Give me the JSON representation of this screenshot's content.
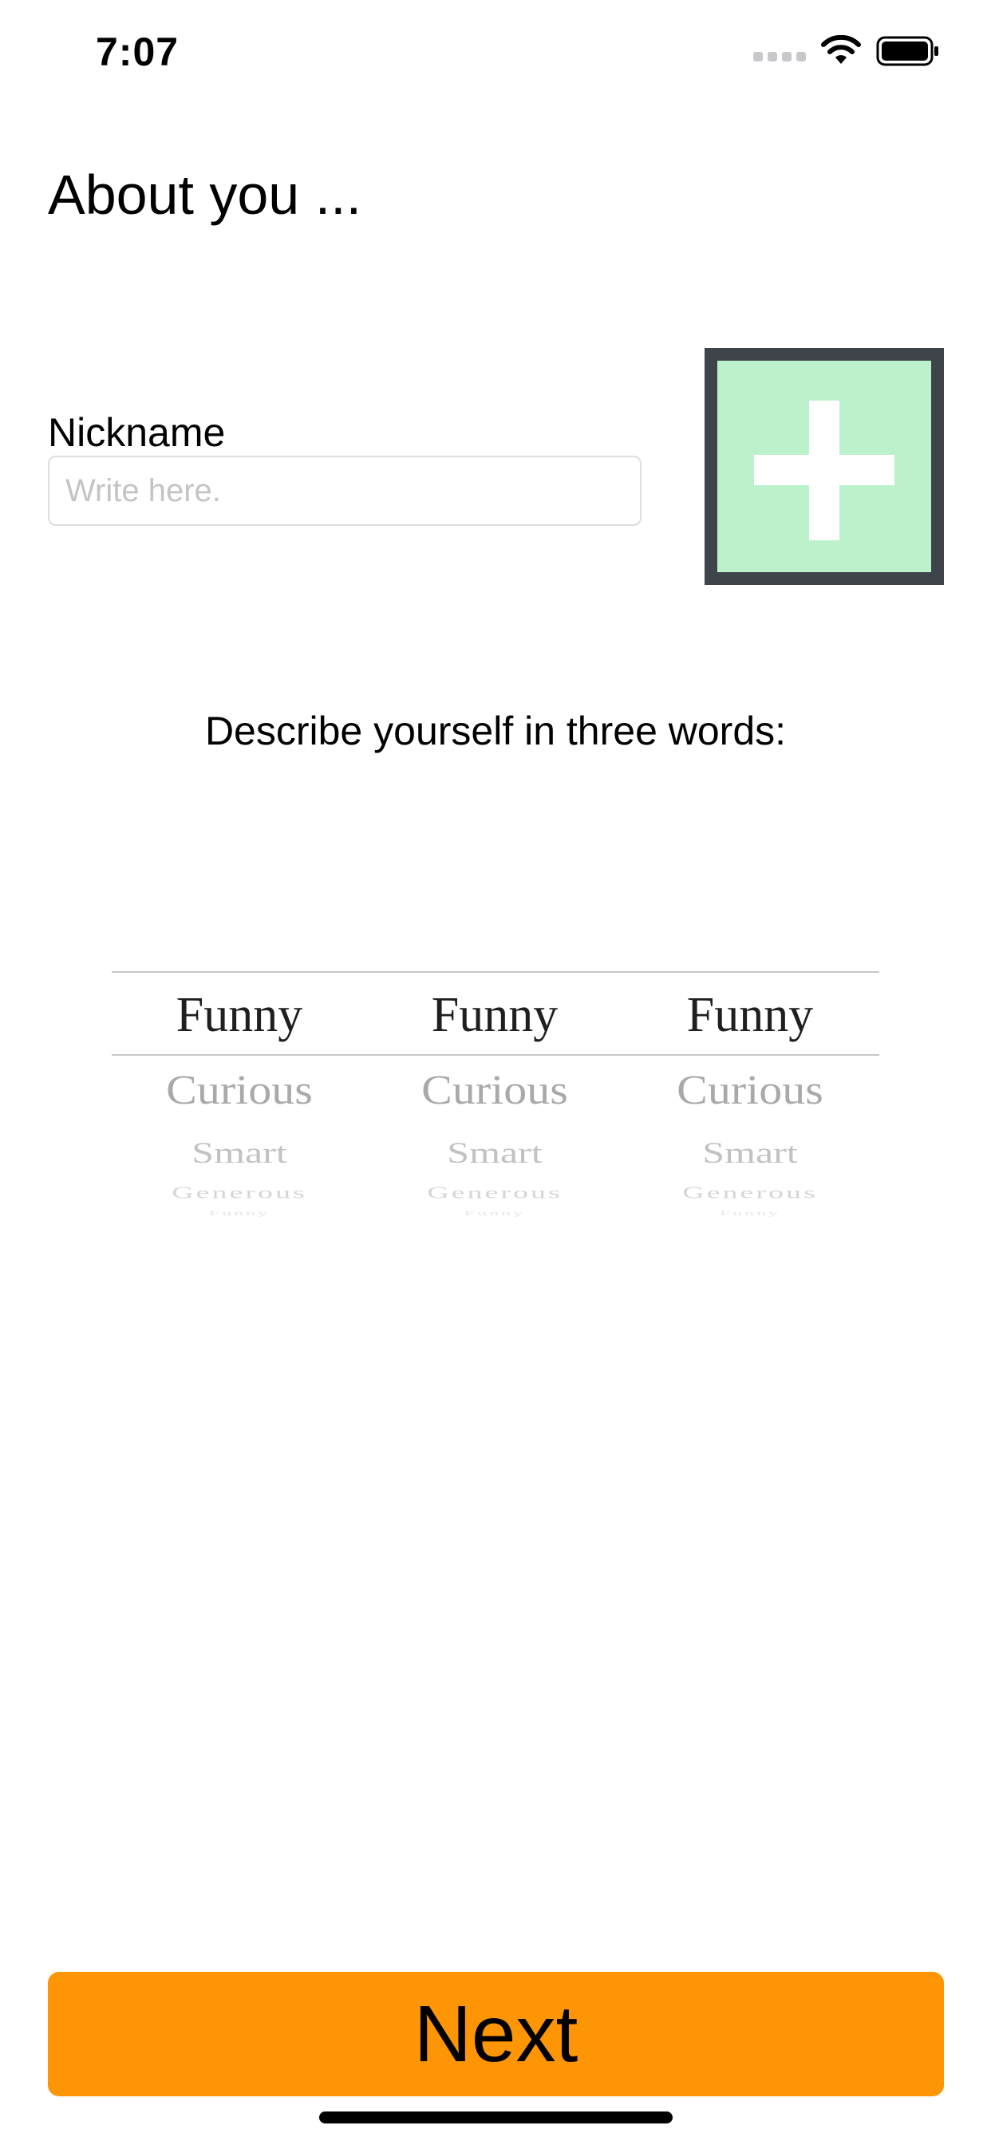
{
  "status_bar": {
    "time": "7:07",
    "icons": [
      "cellular-signal-icon",
      "wifi-icon",
      "battery-icon"
    ]
  },
  "page": {
    "title": "About you ..."
  },
  "nickname": {
    "label": "Nickname",
    "placeholder": "Write here.",
    "value": ""
  },
  "add_photo": {
    "icon": "plus-icon",
    "colors": {
      "fill": "#bbf2cc",
      "border": "#3f444b",
      "plus": "#ffffff"
    }
  },
  "describe": {
    "prompt": "Describe yourself in three words:"
  },
  "picker": {
    "columns": [
      {
        "selected": "Funny",
        "visible_below": [
          "Curious",
          "Smart",
          "Generous",
          "Funny"
        ]
      },
      {
        "selected": "Funny",
        "visible_below": [
          "Curious",
          "Smart",
          "Generous",
          "Funny"
        ]
      },
      {
        "selected": "Funny",
        "visible_below": [
          "Curious",
          "Smart",
          "Generous",
          "Funny"
        ]
      }
    ]
  },
  "next_button": {
    "label": "Next",
    "color": "#fd9504"
  }
}
